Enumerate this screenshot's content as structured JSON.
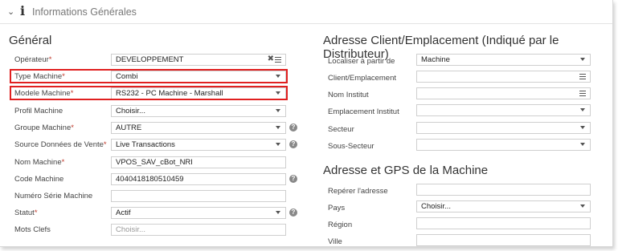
{
  "header": {
    "title": "Informations Générales"
  },
  "general": {
    "title": "Général",
    "operateur": {
      "label": "Opérateur",
      "value": "DEVELOPPEMENT"
    },
    "type_machine": {
      "label": "Type Machine",
      "value": "Combi"
    },
    "modele_machine": {
      "label": "Modele Machine",
      "value": "RS232 - PC Machine - Marshall"
    },
    "profil_machine": {
      "label": "Profil Machine",
      "value": "Choisir..."
    },
    "groupe_machine": {
      "label": "Groupe Machine",
      "value": "AUTRE"
    },
    "source_donnees": {
      "label": "Source Données de Vente",
      "value": "Live Transactions"
    },
    "nom_machine": {
      "label": "Nom Machine",
      "value": "VPOS_SAV_cBot_NRI"
    },
    "code_machine": {
      "label": "Code Machine",
      "value": "4040418180510459"
    },
    "numero_serie": {
      "label": "Numéro Série Machine",
      "value": ""
    },
    "statut": {
      "label": "Statut",
      "value": "Actif"
    },
    "mots_clefs": {
      "label": "Mots Clefs",
      "placeholder": "Choisir..."
    },
    "required_mark": "*"
  },
  "adresse_client": {
    "title": "Adresse Client/Emplacement (Indiqué par le Distributeur)",
    "localiser": {
      "label": "Localiser à partir de",
      "value": "Machine"
    },
    "client_emplacement": {
      "label": "Client/Emplacement",
      "value": ""
    },
    "nom_institut": {
      "label": "Nom Institut",
      "value": ""
    },
    "emplacement_institut": {
      "label": "Emplacement Institut",
      "value": ""
    },
    "secteur": {
      "label": "Secteur",
      "value": ""
    },
    "sous_secteur": {
      "label": "Sous-Secteur",
      "value": ""
    }
  },
  "adresse_gps": {
    "title": "Adresse et GPS de la Machine",
    "reperer": {
      "label": "Repérer l'adresse",
      "value": ""
    },
    "pays": {
      "label": "Pays",
      "value": "Choisir..."
    },
    "region": {
      "label": "Région",
      "value": ""
    },
    "ville": {
      "label": "Ville",
      "value": ""
    }
  },
  "colors": {
    "highlight": "#e02020",
    "required": "#c0392b"
  },
  "icons": {
    "collapse": "chevron-down-icon",
    "info": "info-icon",
    "help": "help-circle-icon",
    "list": "list-icon",
    "clear": "clear-icon",
    "dropdown": "caret-down-icon"
  }
}
